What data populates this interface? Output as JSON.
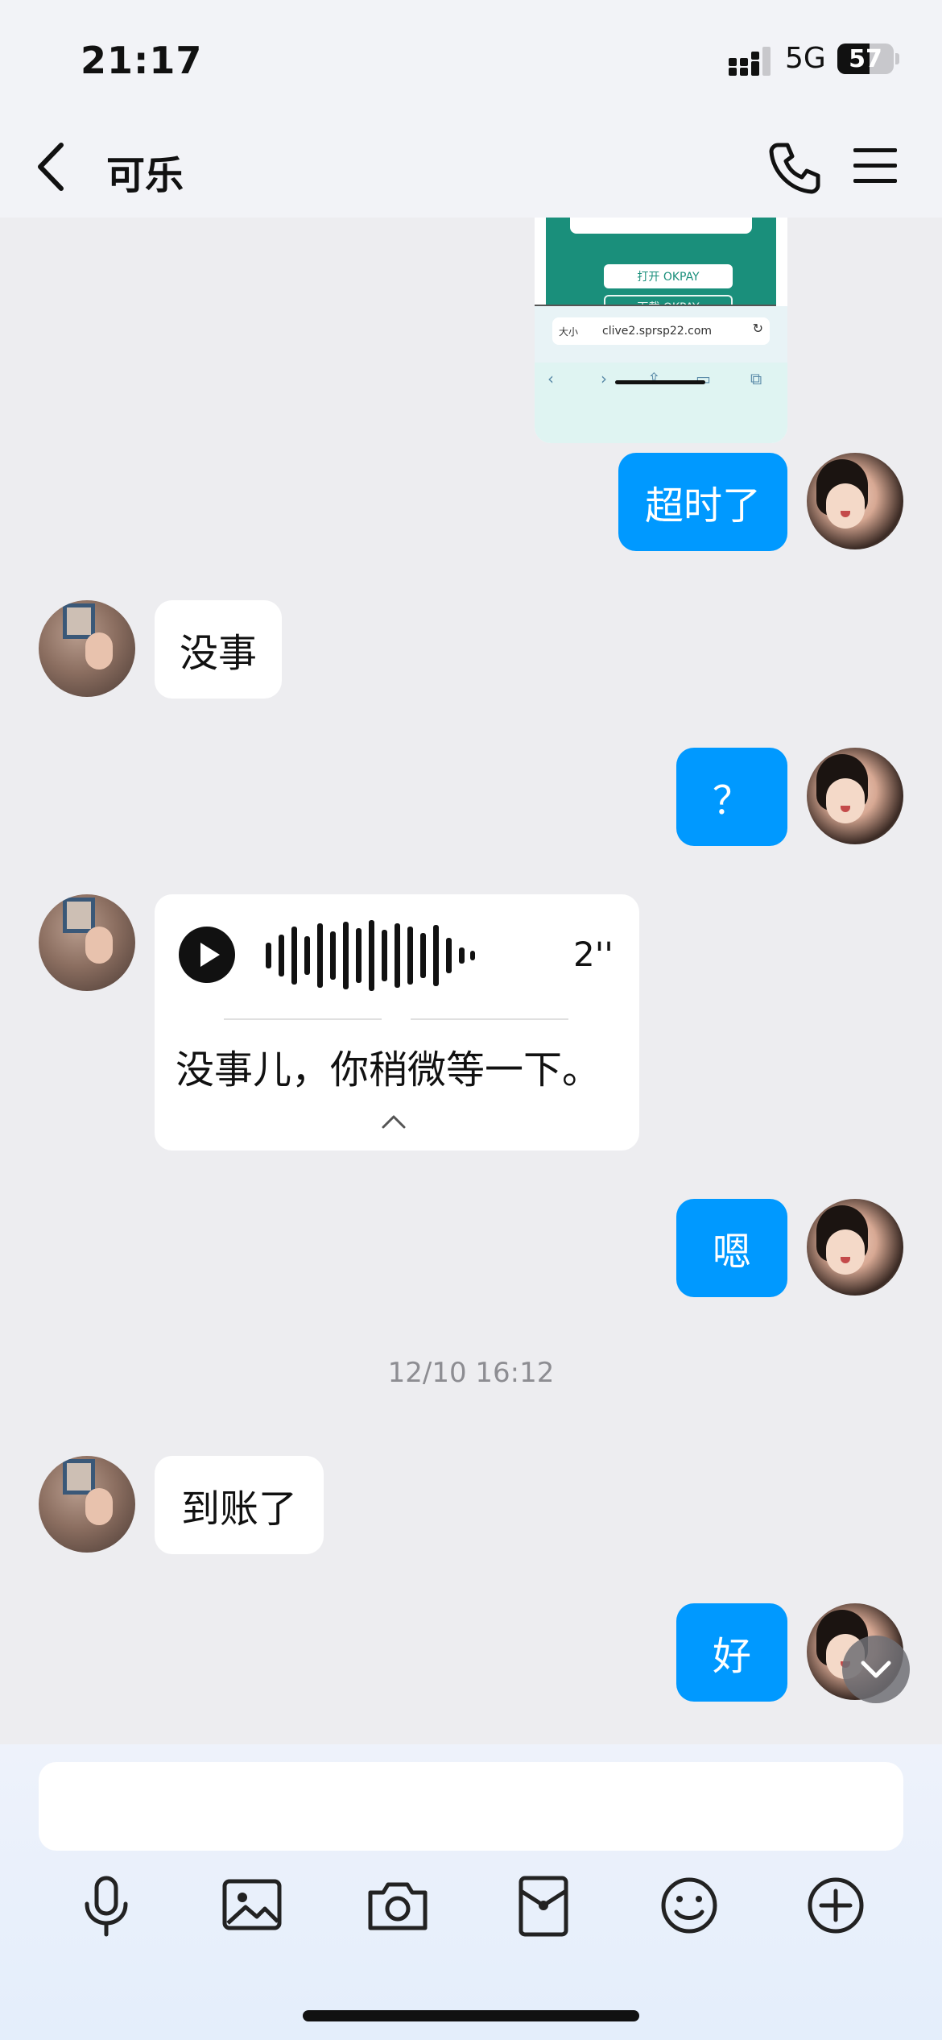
{
  "status_bar": {
    "time": "21:17",
    "network": "5G",
    "battery": 57
  },
  "header": {
    "contact_name": "可乐",
    "back_icon": "chevron-left-icon",
    "call_icon": "phone-icon",
    "menu_icon": "hamburger-menu-icon"
  },
  "shared_screenshot": {
    "open_button": "打开 OKPAY",
    "download_button": "下载 OKPAY",
    "text_size": "大小",
    "url": "clive2.sprsp22.com",
    "reload": "↻",
    "nav_back": "‹",
    "nav_forward": "›",
    "share": "⇪",
    "bookmarks": "▭",
    "tabs": "⧉"
  },
  "messages": [
    {
      "direction": "out",
      "text": "超时了"
    },
    {
      "direction": "in",
      "text": "没事"
    },
    {
      "direction": "out",
      "text": "？"
    },
    {
      "direction": "in",
      "type": "voice",
      "duration": "2''",
      "transcript": "没事儿，你稍微等一下。"
    },
    {
      "direction": "out",
      "text": "嗯"
    },
    {
      "direction": "in",
      "text": "到账了"
    },
    {
      "direction": "out",
      "text": "好"
    }
  ],
  "timestamp": "12/10 16:12",
  "toolbar": {
    "icons": [
      "microphone-icon",
      "image-icon",
      "camera-icon",
      "red-packet-icon",
      "emoji-icon",
      "plus-icon"
    ]
  },
  "colors": {
    "outgoing_bubble": "#0099ff",
    "incoming_bubble": "#ffffff",
    "chat_bg": "#ededf0"
  }
}
